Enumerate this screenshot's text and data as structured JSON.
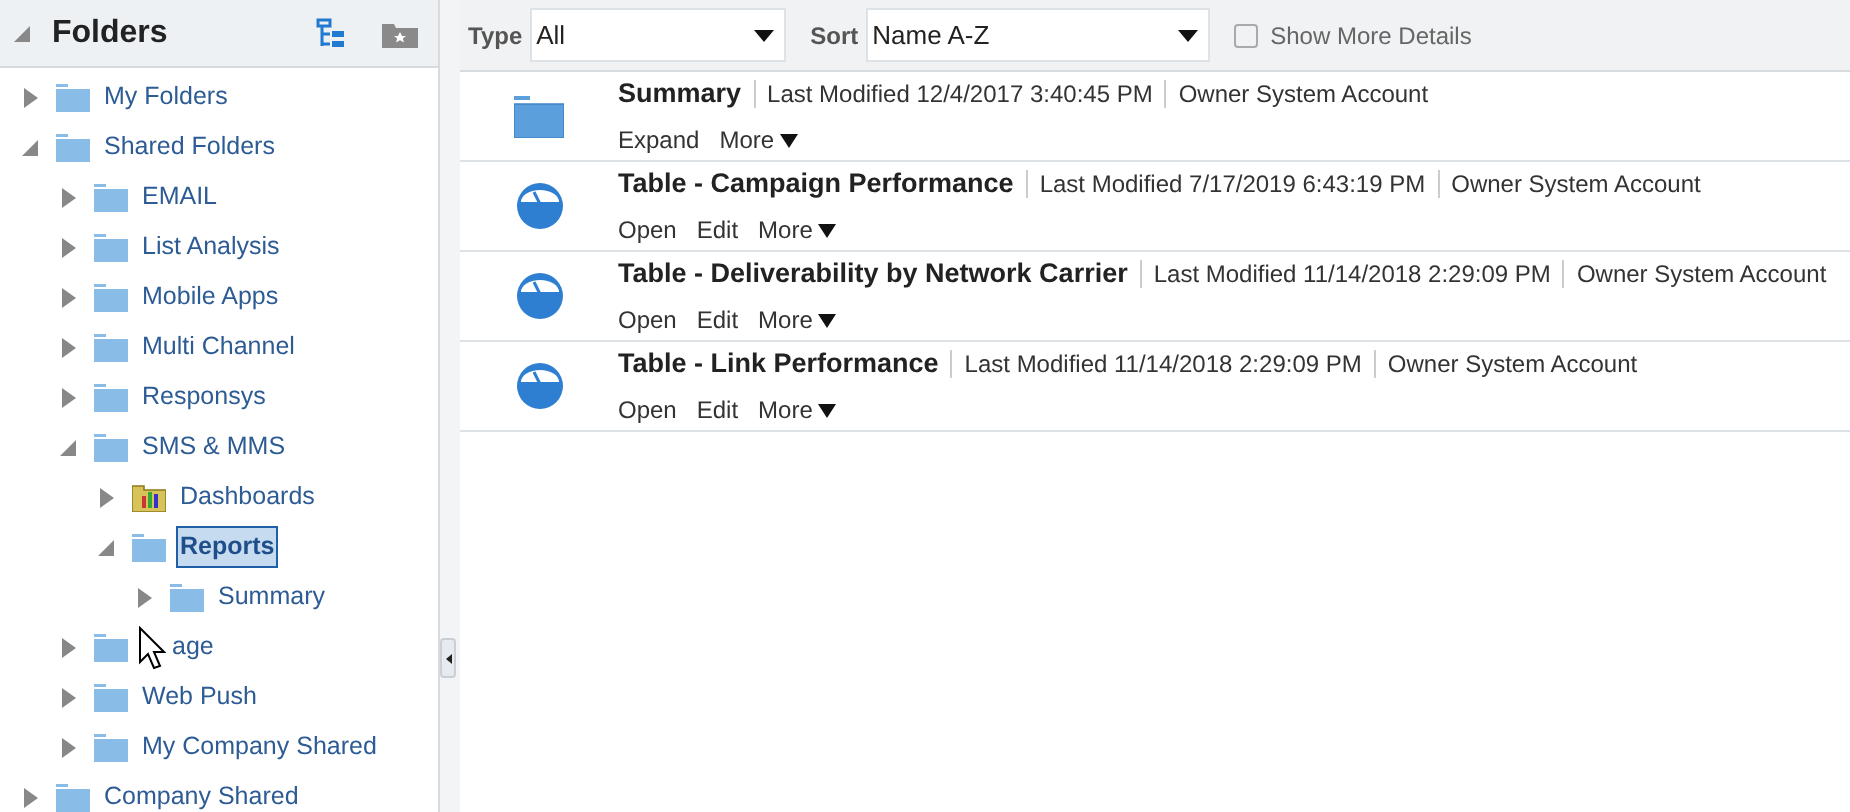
{
  "sidebar": {
    "title": "Folders",
    "expanded": true,
    "tree": [
      {
        "label": "My Folders",
        "kind": "folder",
        "expanded": false,
        "selected": false
      },
      {
        "label": "Shared Folders",
        "kind": "folder",
        "expanded": true,
        "selected": false,
        "children": [
          {
            "label": "EMAIL",
            "kind": "folder",
            "expanded": false,
            "selected": false
          },
          {
            "label": "List Analysis",
            "kind": "folder",
            "expanded": false,
            "selected": false
          },
          {
            "label": "Mobile Apps",
            "kind": "folder",
            "expanded": false,
            "selected": false
          },
          {
            "label": "Multi Channel",
            "kind": "folder",
            "expanded": false,
            "selected": false
          },
          {
            "label": "Responsys",
            "kind": "folder",
            "expanded": false,
            "selected": false
          },
          {
            "label": "SMS & MMS",
            "kind": "folder",
            "expanded": true,
            "selected": false,
            "children": [
              {
                "label": "Dashboards",
                "kind": "dashboard",
                "expanded": false,
                "selected": false
              },
              {
                "label": "Reports",
                "kind": "folder",
                "expanded": true,
                "selected": true,
                "children": [
                  {
                    "label": "Summary",
                    "kind": "folder",
                    "expanded": false,
                    "selected": false
                  }
                ]
              }
            ]
          },
          {
            "label": "age",
            "kind": "folder",
            "expanded": false,
            "selected": false,
            "cursor": true
          },
          {
            "label": "Web Push",
            "kind": "folder",
            "expanded": false,
            "selected": false
          },
          {
            "label": "My Company Shared",
            "kind": "folder",
            "expanded": false,
            "selected": false
          }
        ]
      },
      {
        "label": "Company Shared",
        "kind": "folder",
        "expanded": false,
        "selected": false
      }
    ]
  },
  "toolbar": {
    "type_label": "Type",
    "type_value": "All",
    "sort_label": "Sort",
    "sort_value": "Name A-Z",
    "details_label": "Show More Details",
    "details_checked": false
  },
  "items": [
    {
      "kind": "folder",
      "title": "Summary",
      "modified": "Last Modified 12/4/2017 3:40:45 PM",
      "owner": "Owner System Account",
      "actions": [
        "Expand"
      ],
      "more": "More"
    },
    {
      "kind": "analysis",
      "title": "Table - Campaign Performance",
      "modified": "Last Modified 7/17/2019 6:43:19 PM",
      "owner": "Owner System Account",
      "actions": [
        "Open",
        "Edit"
      ],
      "more": "More"
    },
    {
      "kind": "analysis",
      "title": "Table - Deliverability by Network Carrier",
      "modified": "Last Modified 11/14/2018 2:29:09 PM",
      "owner": "Owner System Account",
      "actions": [
        "Open",
        "Edit"
      ],
      "more": "More"
    },
    {
      "kind": "analysis",
      "title": "Table - Link Performance",
      "modified": "Last Modified 11/14/2018 2:29:09 PM",
      "owner": "Owner System Account",
      "actions": [
        "Open",
        "Edit"
      ],
      "more": "More"
    }
  ]
}
